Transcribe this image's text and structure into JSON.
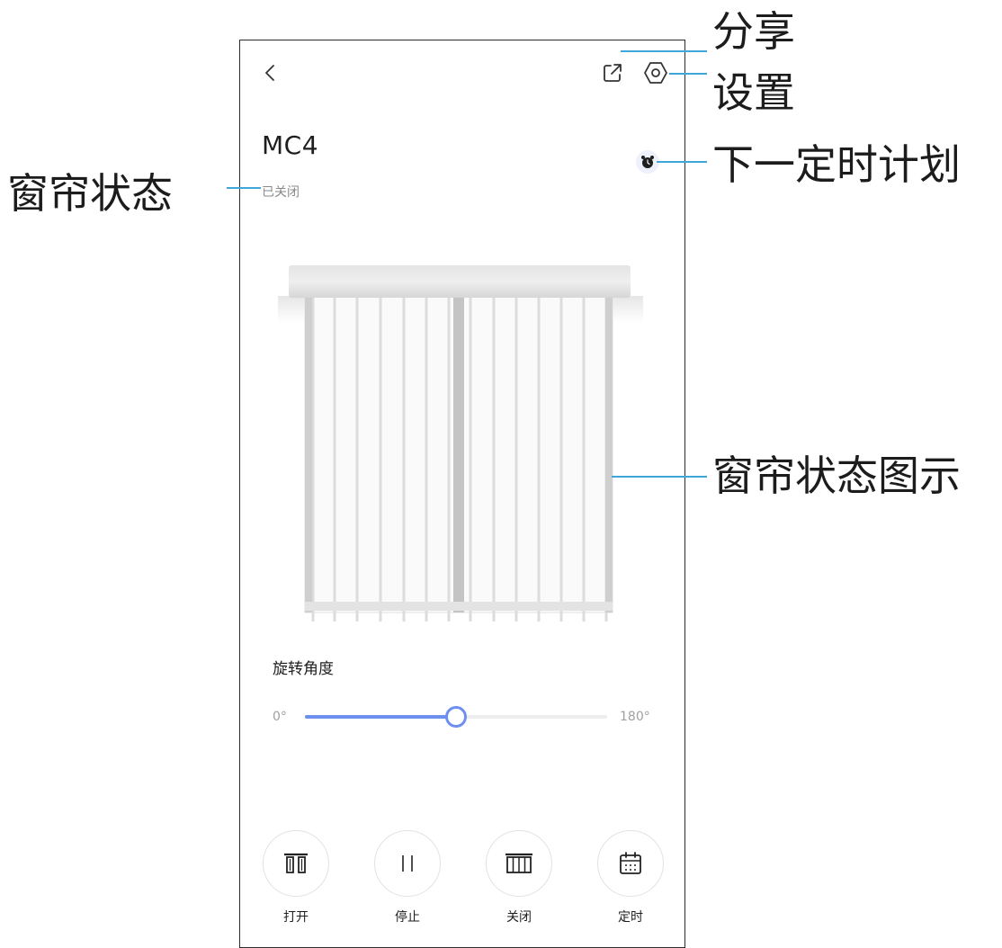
{
  "device": {
    "name": "MC4",
    "status": "已关闭"
  },
  "slider": {
    "label": "旋转角度",
    "min_label": "0°",
    "max_label": "180°",
    "value_fraction": 0.5
  },
  "controls": [
    {
      "label": "打开",
      "icon": "curtain-open-icon"
    },
    {
      "label": "停止",
      "icon": "pause-icon"
    },
    {
      "label": "关闭",
      "icon": "curtain-close-icon"
    },
    {
      "label": "定时",
      "icon": "calendar-icon"
    }
  ],
  "annotations": {
    "share": "分享",
    "settings": "设置",
    "curtain_status": "窗帘状态",
    "next_timer": "下一定时计划",
    "curtain_diagram": "窗帘状态图示"
  },
  "colors": {
    "accent": "#6f8ff0",
    "callout_line": "#3ea6d8"
  }
}
